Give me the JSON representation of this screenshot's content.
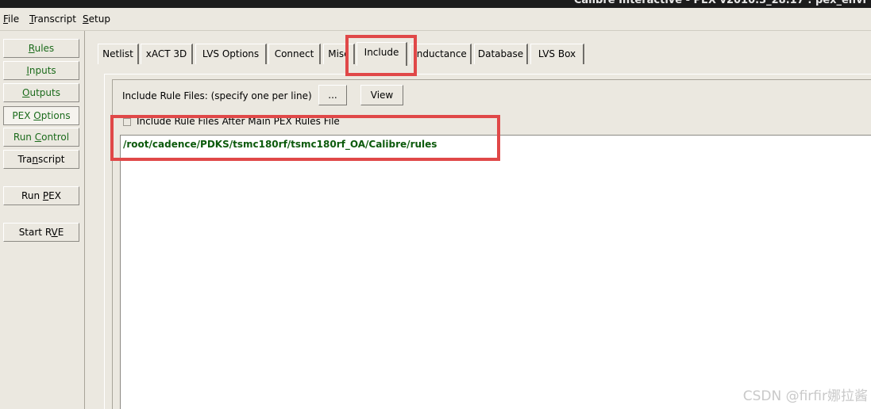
{
  "window": {
    "title": "Calibre Interactive - PEX v2010.3_28.17 : pex_envi"
  },
  "menubar": {
    "file": {
      "hotkey": "F",
      "rest": "ile"
    },
    "transcript": {
      "hotkey": "T",
      "rest": "ranscript"
    },
    "setup": {
      "hotkey": "S",
      "rest": "etup"
    }
  },
  "sidebar": {
    "rules": {
      "pre": "",
      "hotkey": "R",
      "post": "ules"
    },
    "inputs": {
      "pre": "",
      "hotkey": "I",
      "post": "nputs"
    },
    "outputs": {
      "pre": "",
      "hotkey": "O",
      "post": "utputs"
    },
    "pex_options": {
      "pre": "PEX ",
      "hotkey": "O",
      "post": "ptions"
    },
    "run_control": {
      "pre": "Run ",
      "hotkey": "C",
      "post": "ontrol"
    },
    "transcript": {
      "pre": "Tra",
      "hotkey": "n",
      "post": "script"
    },
    "run_pex": {
      "pre": "Run ",
      "hotkey": "P",
      "post": "EX"
    },
    "start_rve": {
      "pre": "Start R",
      "hotkey": "V",
      "post": "E"
    }
  },
  "tabs": {
    "netlist": "Netlist",
    "xact3d": "xACT 3D",
    "lvs_options": "LVS Options",
    "connect": "Connect",
    "misc": "Misc",
    "include": "Include",
    "inductance": "Inductance",
    "database": "Database",
    "lvs_box": "LVS Box"
  },
  "include": {
    "files_label": "Include Rule Files: (specify one per line)",
    "browse_label": "...",
    "view_label": "View",
    "after_main_label": "Include Rule Files After Main PEX Rules File",
    "after_main_checked": false,
    "rule_file_path": "/root/cadence/PDKS/tsmc180rf/tsmc180rf_OA/Calibre/rules"
  },
  "watermark": "CSDN @firfir娜拉酱",
  "colors": {
    "highlight": "#e04848",
    "nav_text": "#1a6a1a",
    "path_text": "#0c5a0c"
  }
}
